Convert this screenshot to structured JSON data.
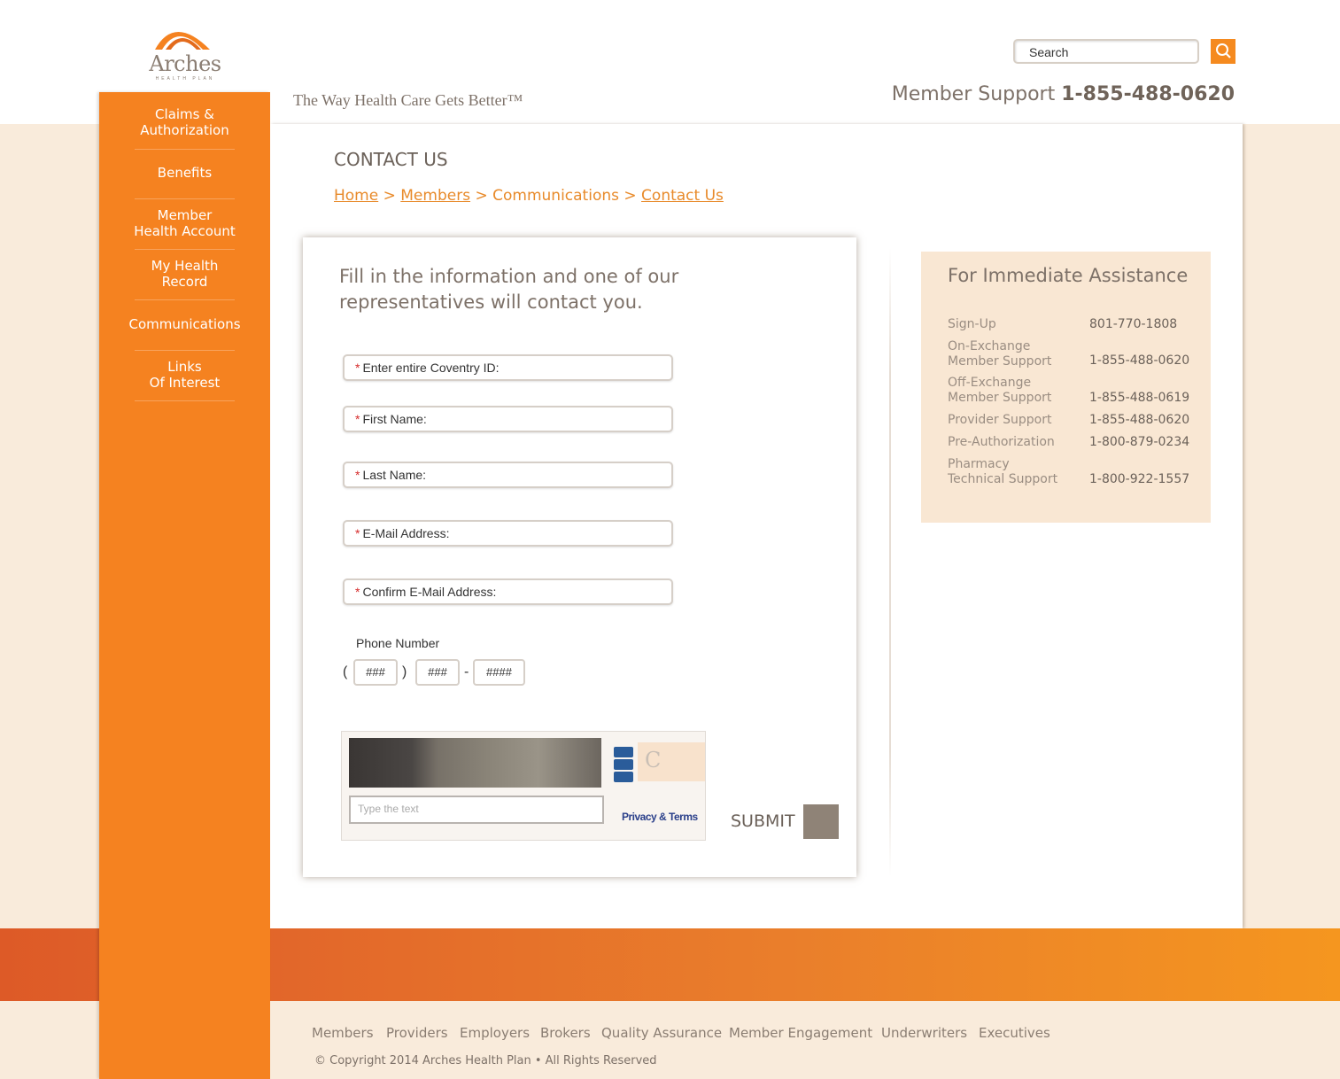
{
  "brand": {
    "name": "Arches",
    "subname": "HEALTH PLAN",
    "tagline": "The Way Health Care Gets Better™",
    "accent_color": "#f58220"
  },
  "header": {
    "search_placeholder": "Search",
    "support_label": "Member Support",
    "support_number": "1-855-488-0620"
  },
  "nav": {
    "claims_line1": "Claims &",
    "claims_line2": "Authorization",
    "benefits": "Benefits",
    "mha_line1": "Member",
    "mha_line2": "Health Account",
    "mhr_line1": "My Health",
    "mhr_line2": "Record",
    "communications": "Communications",
    "links_line1": "Links",
    "links_line2": "Of Interest"
  },
  "page": {
    "title": "CONTACT US",
    "breadcrumb": {
      "home": "Home",
      "sep1": " > ",
      "members": "Members",
      "sep2": "  > ",
      "communications": "Communications",
      "sep3": " >  ",
      "contact": "Contact Us"
    }
  },
  "form": {
    "intro": "Fill in the information and one of our representatives will contact you.",
    "required_mark": "*",
    "coventry_label": "Enter entire Coventry ID:",
    "first_name_label": "First Name:",
    "last_name_label": "Last Name:",
    "email_label": "E-Mail Address:",
    "confirm_email_label": "Confirm E-Mail Address:",
    "phone_label": "Phone Number",
    "phone_open": "(",
    "phone_close": ")",
    "phone_dash": "-",
    "area_placeholder": "###",
    "prefix_placeholder": "###",
    "line_placeholder": "####",
    "captcha_placeholder": "Type the text",
    "captcha_privacy": "Privacy & Terms",
    "submit": "SUBMIT"
  },
  "assistance": {
    "title": "For Immediate Assistance",
    "rows": [
      {
        "label1": "Sign-Up",
        "label2": "",
        "number": "801-770-1808"
      },
      {
        "label1": "On-Exchange",
        "label2": "Member Support",
        "number": "1-855-488-0620"
      },
      {
        "label1": "Off-Exchange",
        "label2": "Member Support",
        "number": "1-855-488-0619"
      },
      {
        "label1": "Provider Support",
        "label2": "",
        "number": "1-855-488-0620"
      },
      {
        "label1": "Pre-Authorization",
        "label2": "",
        "number": "1-800-879-0234"
      },
      {
        "label1": "Pharmacy",
        "label2": "Technical Support",
        "number": "1-800-922-1557"
      }
    ]
  },
  "footer": {
    "links": [
      "Members",
      "Providers",
      "Employers",
      "Brokers",
      "Quality Assurance",
      "Member Engagement",
      "Underwriters",
      "Executives"
    ],
    "copyright": "© Copyright 2014 Arches Health Plan • All Rights Reserved"
  }
}
